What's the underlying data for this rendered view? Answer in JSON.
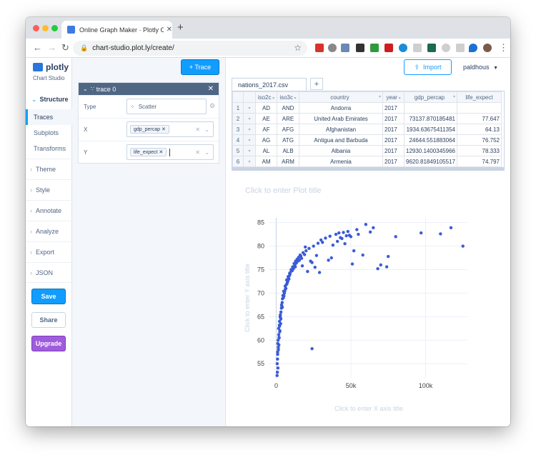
{
  "browser": {
    "tab_title": "Online Graph Maker · Plotly Ch",
    "tab_close": "✕",
    "new_tab": "+",
    "url": "chart-studio.plot.ly/create/",
    "back": "←",
    "forward": "→",
    "reload": "↻",
    "star": "☆",
    "menu": "⋮"
  },
  "sidebar": {
    "logo": "plotly",
    "subtitle": "Chart Studio",
    "structure": "Structure",
    "sub_items": [
      "Traces",
      "Subplots",
      "Transforms"
    ],
    "items": [
      "Theme",
      "Style",
      "Annotate",
      "Analyze",
      "Export",
      "JSON"
    ],
    "save": "Save",
    "share": "Share",
    "upgrade": "Upgrade"
  },
  "panel": {
    "add_trace": "+ Trace",
    "trace_name": "trace 0",
    "type_label": "Type",
    "type_value": "Scatter",
    "x_label": "X",
    "x_value": "gdp_percap",
    "y_label": "Y",
    "y_value": "life_expect"
  },
  "main": {
    "import": "Import",
    "user": "paldhous",
    "file_tab": "nations_2017.csv",
    "add_tab": "+",
    "columns": [
      "iso2c",
      "iso3c",
      "country",
      "year",
      "gdp_percap",
      "life_expect"
    ],
    "rows": [
      [
        "1",
        "AD",
        "AND",
        "Andorra",
        "2017",
        "",
        ""
      ],
      [
        "2",
        "AE",
        "ARE",
        "United Arab Emirates",
        "2017",
        "73137.870185481",
        "77.647"
      ],
      [
        "3",
        "AF",
        "AFG",
        "Afghanistan",
        "2017",
        "1934.63675411354",
        "64.13"
      ],
      [
        "4",
        "AG",
        "ATG",
        "Antigua and Barbuda",
        "2017",
        "24644.551883064",
        "76.752"
      ],
      [
        "5",
        "AL",
        "ALB",
        "Albania",
        "2017",
        "12930.1400345966",
        "78.333"
      ],
      [
        "6",
        "AM",
        "ARM",
        "Armenia",
        "2017",
        "9620.81849105517",
        "74.797"
      ]
    ],
    "plot_title_placeholder": "Click to enter Plot title",
    "x_axis_placeholder": "Click to enter X axis title",
    "y_axis_placeholder": "Click to enter Y axis title"
  },
  "chart_data": {
    "type": "scatter",
    "xlim": [
      -5000,
      128000
    ],
    "ylim": [
      52,
      86
    ],
    "x_ticks": [
      0,
      50000,
      100000
    ],
    "x_tick_labels": [
      "0",
      "50k",
      "100k"
    ],
    "y_ticks": [
      55,
      60,
      65,
      70,
      75,
      80,
      85
    ],
    "y_tick_labels": [
      "55",
      "60",
      "65",
      "70",
      "75",
      "80",
      "85"
    ],
    "marker_color": "#3b5bd6",
    "x": [
      800,
      1200,
      1500,
      2000,
      2500,
      3000,
      900,
      1100,
      1700,
      2200,
      2800,
      3500,
      4000,
      4500,
      5000,
      6000,
      7000,
      8000,
      9000,
      10000,
      11000,
      12000,
      13000,
      14000,
      15000,
      16000,
      18000,
      20000,
      22000,
      25000,
      28000,
      30000,
      33000,
      36000,
      40000,
      42000,
      45000,
      48000,
      50000,
      55000,
      60000,
      65000,
      70000,
      75000,
      80000,
      97000,
      110000,
      117000,
      125000,
      1000,
      1300,
      1600,
      2100,
      2600,
      3200,
      3800,
      4200,
      5500,
      6500,
      7500,
      8500,
      9500,
      10500,
      12500,
      14500,
      17000,
      19000,
      23000,
      26000,
      29000,
      35000,
      38000,
      41000,
      44000,
      47000,
      52000,
      58000,
      63000,
      68000,
      74000,
      700,
      1400,
      1900,
      2400,
      3100,
      4100,
      5200,
      6200,
      7200,
      8200,
      9200,
      11500,
      13500,
      15500,
      17500,
      21000,
      24000,
      27000,
      31000,
      37000,
      43000,
      46000,
      49000,
      51000,
      54000,
      600,
      1000,
      1800,
      2300,
      2900,
      3600,
      4800,
      5800,
      6800,
      7800,
      8800,
      10800,
      12800,
      16500,
      19500,
      24000
    ],
    "y": [
      53.2,
      54.1,
      58.0,
      60.5,
      62.0,
      63.5,
      56.0,
      59.3,
      61.2,
      64.0,
      65.4,
      66.8,
      68.0,
      69.5,
      70.4,
      71.5,
      72.8,
      73.5,
      74.2,
      75.0,
      75.6,
      76.3,
      76.8,
      77.2,
      77.6,
      78.1,
      78.6,
      79.0,
      79.5,
      80.0,
      80.6,
      81.3,
      81.7,
      82.1,
      82.5,
      82.8,
      82.9,
      83.1,
      82.0,
      82.5,
      84.6,
      83.9,
      76.0,
      77.8,
      82.0,
      82.8,
      82.6,
      83.9,
      80.0,
      57.0,
      60.0,
      62.5,
      63.2,
      65.0,
      66.0,
      67.2,
      68.8,
      70.0,
      71.0,
      72.3,
      73.0,
      74.4,
      74.9,
      76.0,
      76.8,
      77.4,
      78.2,
      76.8,
      75.5,
      74.4,
      77.0,
      80.2,
      81.0,
      81.6,
      82.2,
      79.0,
      78.1,
      83.0,
      75.2,
      75.6,
      55.0,
      58.5,
      60.6,
      61.8,
      64.5,
      67.0,
      69.4,
      70.9,
      72.0,
      73.2,
      74.0,
      75.2,
      76.4,
      77.0,
      75.8,
      74.6,
      76.5,
      78.0,
      80.8,
      77.5,
      81.8,
      80.5,
      82.3,
      76.2,
      83.5,
      52.5,
      57.5,
      59.0,
      63.0,
      64.8,
      67.5,
      69.0,
      70.5,
      71.8,
      72.6,
      73.7,
      74.8,
      75.6,
      77.9,
      79.8,
      58.2
    ]
  }
}
